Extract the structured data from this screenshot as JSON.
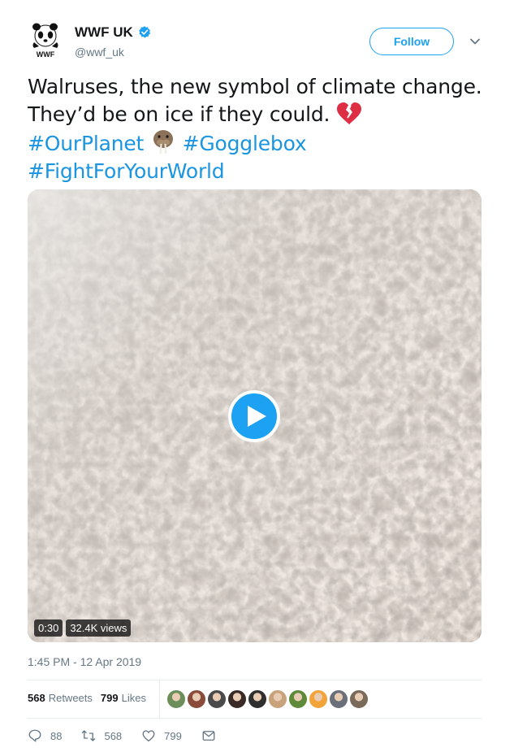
{
  "account": {
    "display_name": "WWF UK",
    "handle": "@wwf_uk",
    "avatar_label": "WWF",
    "verified": true
  },
  "follow_button": {
    "label": "Follow"
  },
  "tweet": {
    "line1": "Walruses, the new symbol of climate change.",
    "line2": "They’d be on ice if they could.",
    "hashtags": [
      "#OurPlanet",
      "#Gogglebox",
      "#FightForYourWorld"
    ],
    "emojis": [
      "broken-heart-emoji",
      "walrus-face-emoji"
    ]
  },
  "media": {
    "duration": "0:30",
    "views": "32.4K views"
  },
  "timestamp": "1:45 PM - 12 Apr 2019",
  "stats": {
    "retweets_count": "568",
    "retweets_label": "Retweets",
    "likes_count": "799",
    "likes_label": "Likes"
  },
  "likers": [
    {
      "color": "#6b8e5a"
    },
    {
      "color": "#8a4b3a"
    },
    {
      "color": "#4a4a4a"
    },
    {
      "color": "#3a2a26"
    },
    {
      "color": "#2f2f2f"
    },
    {
      "color": "#c8a27a"
    },
    {
      "color": "#5f8a3a"
    },
    {
      "color": "#f2a33a"
    },
    {
      "color": "#6a6f7a"
    },
    {
      "color": "#7a6a5a"
    }
  ],
  "actions": {
    "replies": "88",
    "retweets": "568",
    "likes": "799"
  },
  "colors": {
    "accent": "#1da1f2",
    "hashtag": "#1b95e0",
    "muted": "#657786"
  }
}
